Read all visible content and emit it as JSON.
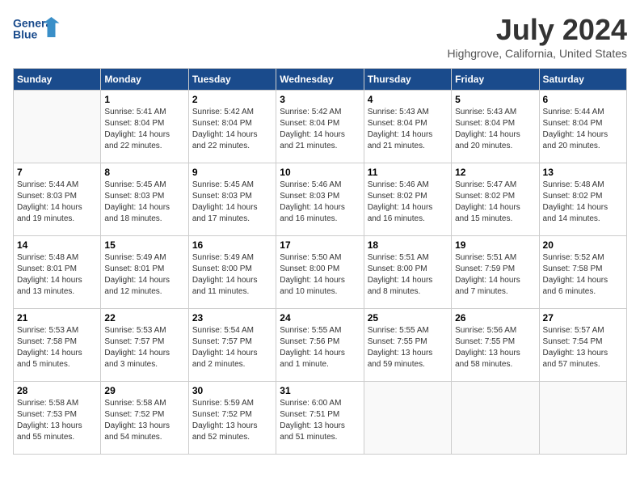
{
  "header": {
    "logo_line1": "General",
    "logo_line2": "Blue",
    "month_year": "July 2024",
    "location": "Highgrove, California, United States"
  },
  "weekdays": [
    "Sunday",
    "Monday",
    "Tuesday",
    "Wednesday",
    "Thursday",
    "Friday",
    "Saturday"
  ],
  "weeks": [
    [
      {
        "day": "",
        "info": ""
      },
      {
        "day": "1",
        "info": "Sunrise: 5:41 AM\nSunset: 8:04 PM\nDaylight: 14 hours\nand 22 minutes."
      },
      {
        "day": "2",
        "info": "Sunrise: 5:42 AM\nSunset: 8:04 PM\nDaylight: 14 hours\nand 22 minutes."
      },
      {
        "day": "3",
        "info": "Sunrise: 5:42 AM\nSunset: 8:04 PM\nDaylight: 14 hours\nand 21 minutes."
      },
      {
        "day": "4",
        "info": "Sunrise: 5:43 AM\nSunset: 8:04 PM\nDaylight: 14 hours\nand 21 minutes."
      },
      {
        "day": "5",
        "info": "Sunrise: 5:43 AM\nSunset: 8:04 PM\nDaylight: 14 hours\nand 20 minutes."
      },
      {
        "day": "6",
        "info": "Sunrise: 5:44 AM\nSunset: 8:04 PM\nDaylight: 14 hours\nand 20 minutes."
      }
    ],
    [
      {
        "day": "7",
        "info": "Sunrise: 5:44 AM\nSunset: 8:03 PM\nDaylight: 14 hours\nand 19 minutes."
      },
      {
        "day": "8",
        "info": "Sunrise: 5:45 AM\nSunset: 8:03 PM\nDaylight: 14 hours\nand 18 minutes."
      },
      {
        "day": "9",
        "info": "Sunrise: 5:45 AM\nSunset: 8:03 PM\nDaylight: 14 hours\nand 17 minutes."
      },
      {
        "day": "10",
        "info": "Sunrise: 5:46 AM\nSunset: 8:03 PM\nDaylight: 14 hours\nand 16 minutes."
      },
      {
        "day": "11",
        "info": "Sunrise: 5:46 AM\nSunset: 8:02 PM\nDaylight: 14 hours\nand 16 minutes."
      },
      {
        "day": "12",
        "info": "Sunrise: 5:47 AM\nSunset: 8:02 PM\nDaylight: 14 hours\nand 15 minutes."
      },
      {
        "day": "13",
        "info": "Sunrise: 5:48 AM\nSunset: 8:02 PM\nDaylight: 14 hours\nand 14 minutes."
      }
    ],
    [
      {
        "day": "14",
        "info": "Sunrise: 5:48 AM\nSunset: 8:01 PM\nDaylight: 14 hours\nand 13 minutes."
      },
      {
        "day": "15",
        "info": "Sunrise: 5:49 AM\nSunset: 8:01 PM\nDaylight: 14 hours\nand 12 minutes."
      },
      {
        "day": "16",
        "info": "Sunrise: 5:49 AM\nSunset: 8:00 PM\nDaylight: 14 hours\nand 11 minutes."
      },
      {
        "day": "17",
        "info": "Sunrise: 5:50 AM\nSunset: 8:00 PM\nDaylight: 14 hours\nand 10 minutes."
      },
      {
        "day": "18",
        "info": "Sunrise: 5:51 AM\nSunset: 8:00 PM\nDaylight: 14 hours\nand 8 minutes."
      },
      {
        "day": "19",
        "info": "Sunrise: 5:51 AM\nSunset: 7:59 PM\nDaylight: 14 hours\nand 7 minutes."
      },
      {
        "day": "20",
        "info": "Sunrise: 5:52 AM\nSunset: 7:58 PM\nDaylight: 14 hours\nand 6 minutes."
      }
    ],
    [
      {
        "day": "21",
        "info": "Sunrise: 5:53 AM\nSunset: 7:58 PM\nDaylight: 14 hours\nand 5 minutes."
      },
      {
        "day": "22",
        "info": "Sunrise: 5:53 AM\nSunset: 7:57 PM\nDaylight: 14 hours\nand 3 minutes."
      },
      {
        "day": "23",
        "info": "Sunrise: 5:54 AM\nSunset: 7:57 PM\nDaylight: 14 hours\nand 2 minutes."
      },
      {
        "day": "24",
        "info": "Sunrise: 5:55 AM\nSunset: 7:56 PM\nDaylight: 14 hours\nand 1 minute."
      },
      {
        "day": "25",
        "info": "Sunrise: 5:55 AM\nSunset: 7:55 PM\nDaylight: 13 hours\nand 59 minutes."
      },
      {
        "day": "26",
        "info": "Sunrise: 5:56 AM\nSunset: 7:55 PM\nDaylight: 13 hours\nand 58 minutes."
      },
      {
        "day": "27",
        "info": "Sunrise: 5:57 AM\nSunset: 7:54 PM\nDaylight: 13 hours\nand 57 minutes."
      }
    ],
    [
      {
        "day": "28",
        "info": "Sunrise: 5:58 AM\nSunset: 7:53 PM\nDaylight: 13 hours\nand 55 minutes."
      },
      {
        "day": "29",
        "info": "Sunrise: 5:58 AM\nSunset: 7:52 PM\nDaylight: 13 hours\nand 54 minutes."
      },
      {
        "day": "30",
        "info": "Sunrise: 5:59 AM\nSunset: 7:52 PM\nDaylight: 13 hours\nand 52 minutes."
      },
      {
        "day": "31",
        "info": "Sunrise: 6:00 AM\nSunset: 7:51 PM\nDaylight: 13 hours\nand 51 minutes."
      },
      {
        "day": "",
        "info": ""
      },
      {
        "day": "",
        "info": ""
      },
      {
        "day": "",
        "info": ""
      }
    ]
  ]
}
